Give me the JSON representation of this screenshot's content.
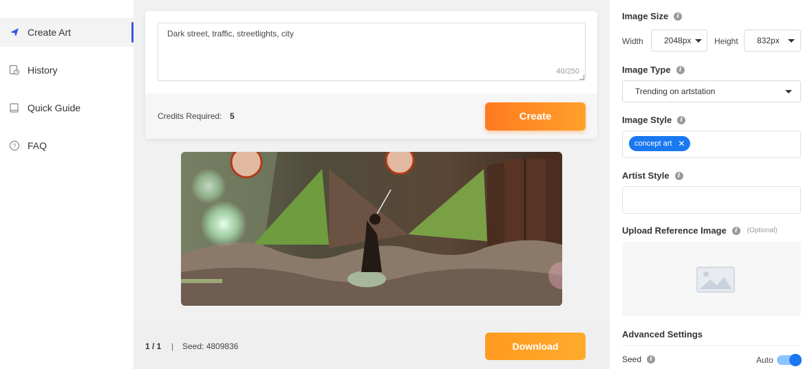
{
  "sidebar": {
    "items": [
      {
        "label": "Create Art",
        "icon": "paper-plane-icon",
        "active": true
      },
      {
        "label": "History",
        "icon": "history-icon"
      },
      {
        "label": "Quick Guide",
        "icon": "book-icon"
      },
      {
        "label": "FAQ",
        "icon": "question-icon"
      }
    ],
    "accent": "#3a55e0"
  },
  "prompt": {
    "value": "Dark street, traffic, streetlights, city",
    "count": "40/250"
  },
  "credits": {
    "label": "Credits Required:",
    "value": "5"
  },
  "create_label": "Create",
  "footer": {
    "page": "1 / 1",
    "separator": "|",
    "seed": "Seed: 4809836",
    "download_label": "Download"
  },
  "panel": {
    "image_size": {
      "title": "Image Size",
      "width_label": "Width",
      "width_value": "2048px",
      "height_label": "Height",
      "height_value": "832px"
    },
    "image_type": {
      "title": "Image Type",
      "value": "Trending on artstation"
    },
    "image_style": {
      "title": "Image Style",
      "tag": "concept art"
    },
    "artist_style": {
      "title": "Artist Style"
    },
    "upload": {
      "title": "Upload Reference Image",
      "optional": "(Optional)"
    },
    "advanced": {
      "title": "Advanced Settings",
      "seed_label": "Seed",
      "auto_label": "Auto",
      "auto_on": true
    }
  },
  "colors": {
    "orange": "#ff8a22",
    "blue": "#1a78f0"
  }
}
